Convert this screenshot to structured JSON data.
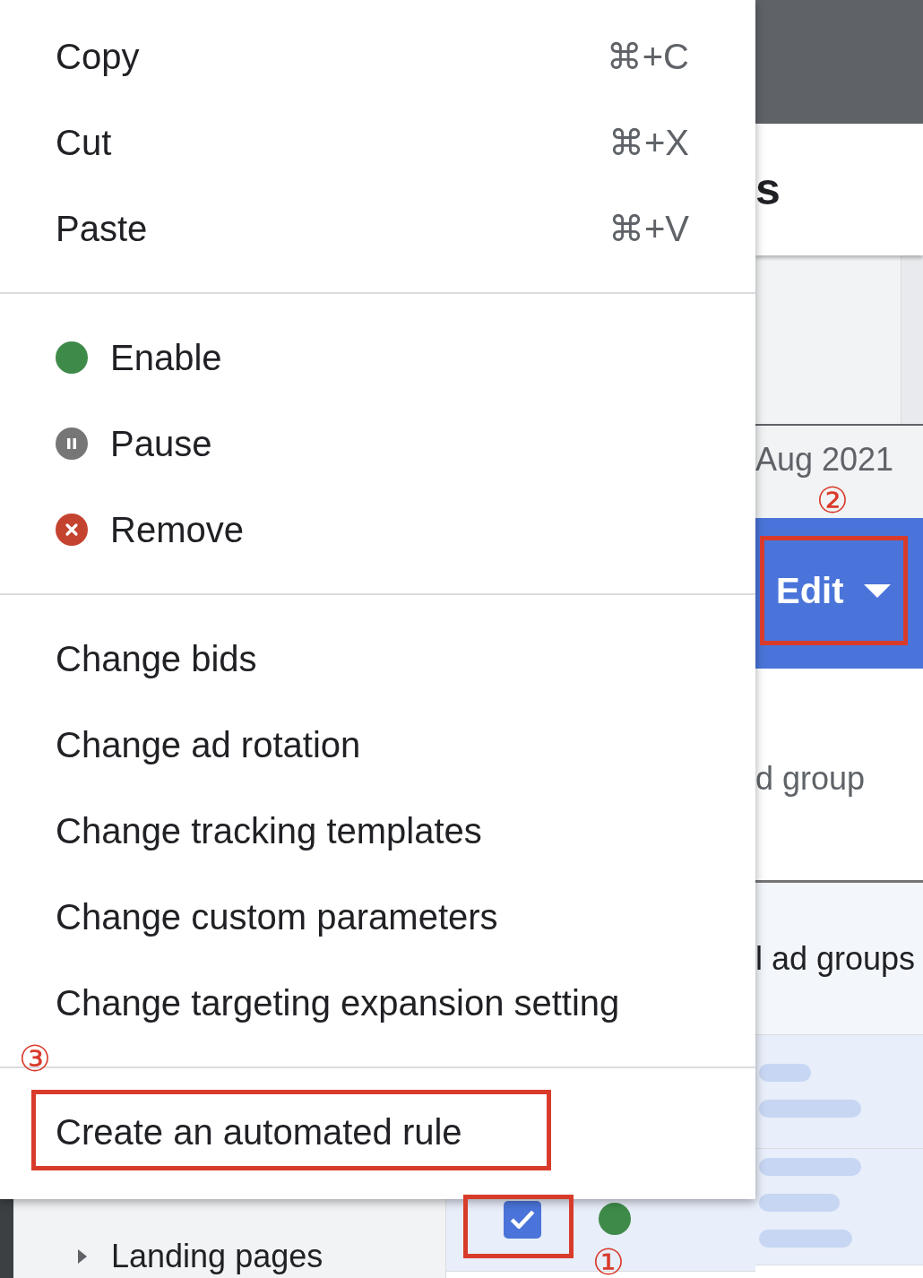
{
  "context_menu": {
    "sections": [
      {
        "items": [
          {
            "kind": "shortcut",
            "label": "Copy",
            "shortcut": "⌘+C"
          },
          {
            "kind": "shortcut",
            "label": "Cut",
            "shortcut": "⌘+X"
          },
          {
            "kind": "shortcut",
            "label": "Paste",
            "shortcut": "⌘+V"
          }
        ]
      },
      {
        "items": [
          {
            "kind": "enable",
            "label": "Enable",
            "color": "#3e8a49"
          },
          {
            "kind": "pause",
            "label": "Pause",
            "color": "#767676"
          },
          {
            "kind": "remove",
            "label": "Remove",
            "color": "#c4432f"
          }
        ]
      },
      {
        "items": [
          {
            "kind": "plain",
            "label": "Change bids"
          },
          {
            "kind": "plain",
            "label": "Change ad rotation"
          },
          {
            "kind": "plain",
            "label": "Change tracking templates"
          },
          {
            "kind": "plain",
            "label": "Change custom parameters"
          },
          {
            "kind": "plain",
            "label": "Change targeting expansion setting"
          }
        ]
      },
      {
        "items": [
          {
            "kind": "plain",
            "label": "Create an automated rule",
            "annotation": "③"
          }
        ]
      }
    ]
  },
  "page_title": "s",
  "date_range": "Aug 2021",
  "selection_bar": {
    "edit_button": {
      "label": "Edit",
      "annotation": "②"
    }
  },
  "table": {
    "column_header": "d group",
    "total_row": "l ad groups",
    "rows": [
      {
        "checked": true,
        "color": "#3e8a49",
        "annotation": "①"
      }
    ]
  },
  "sidebar": {
    "items": [
      {
        "label": "Landing pages",
        "expanded": false
      }
    ]
  }
}
